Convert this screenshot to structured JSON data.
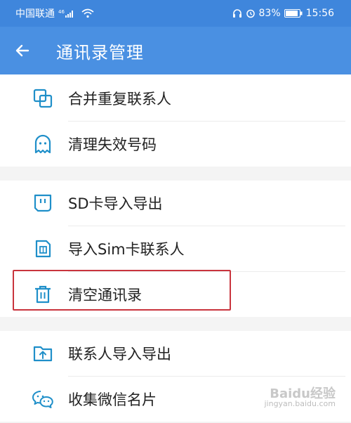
{
  "status_bar": {
    "carrier": "中国联通",
    "signal_label": "46",
    "battery": "83%",
    "time": "15:56"
  },
  "app_bar": {
    "title": "通讯录管理",
    "back_icon": "arrow-left-icon"
  },
  "menu_sections": [
    {
      "items": [
        {
          "label": "合并重复联系人",
          "icon": "merge-icon"
        },
        {
          "label": "清理失效号码",
          "icon": "ghost-icon"
        }
      ]
    },
    {
      "items": [
        {
          "label": "SD卡导入导出",
          "icon": "sd-card-icon"
        },
        {
          "label": "导入Sim卡联系人",
          "icon": "sim-card-icon"
        },
        {
          "label": "清空通讯录",
          "icon": "trash-icon",
          "highlighted": true
        }
      ]
    },
    {
      "items": [
        {
          "label": "联系人导入导出",
          "icon": "folder-upload-icon"
        },
        {
          "label": "收集微信名片",
          "icon": "wechat-icon"
        }
      ]
    }
  ],
  "colors": {
    "status_bar": "#3f86dc",
    "app_bar": "#4a90e2",
    "icon": "#1f8fc9",
    "highlight": "#c9343d"
  },
  "watermark": {
    "text": "Baidu经验",
    "sub": "jingyan.baidu.com"
  }
}
